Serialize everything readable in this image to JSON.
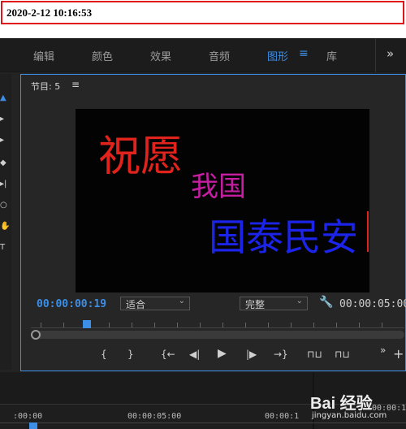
{
  "header": {
    "timestamp": "2020-2-12 10:16:53"
  },
  "workspace_tabs": [
    {
      "label": "编辑",
      "active": false
    },
    {
      "label": "颜色",
      "active": false
    },
    {
      "label": "效果",
      "active": false
    },
    {
      "label": "音频",
      "active": false
    },
    {
      "label": "图形",
      "active": true
    },
    {
      "label": "库",
      "active": false
    }
  ],
  "tab_menu_glyph": "≡",
  "tab_more_glyph": "»",
  "accent_color": "#3d8ee6",
  "program_monitor": {
    "title": "节目: 5",
    "menu_glyph": "≡",
    "current_timecode": "00:00:00:19",
    "fit_dropdown": "适合",
    "quality_dropdown": "完整",
    "duration_timecode": "00:00:05:00",
    "playhead_fraction": 0.15
  },
  "screen_text": [
    {
      "text": "祝愿",
      "color": "#e0231d"
    },
    {
      "text": "我国",
      "color": "#c51ea0"
    },
    {
      "text": "国泰民安",
      "color": "#1b24e8"
    }
  ],
  "controls": {
    "mark_in": "{",
    "mark_out": "}",
    "go_to_in": "{←",
    "step_back": "◀|",
    "play": "▶",
    "step_forward": "|▶",
    "go_to_out": "→}",
    "lift": "⊓⊔",
    "extract": "⊓⊔",
    "more": "»",
    "add": "+"
  },
  "timeline": {
    "times": [
      ":00:00",
      "00:00:05:00",
      "00:00:1",
      "00:00:1"
    ]
  },
  "watermark": {
    "logo": "Bai 经验",
    "url": "jingyan.baidu.com"
  }
}
